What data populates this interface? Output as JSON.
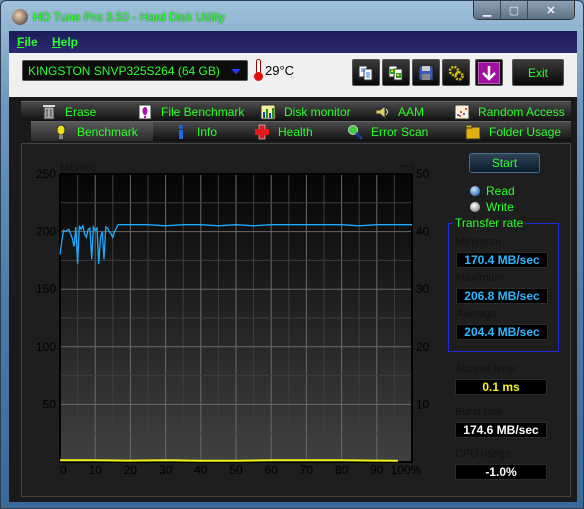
{
  "window": {
    "title": "HD Tune Pro 3.50 - Hard Disk Utility",
    "controls": [
      "minimize",
      "maximize",
      "close"
    ]
  },
  "menu": [
    {
      "label": "File",
      "accel": "F",
      "rest": "ile"
    },
    {
      "label": "Help",
      "accel": "H",
      "rest": "elp"
    }
  ],
  "toolbar": {
    "drive": "KINGSTON SNVP325S264 (64 GB)",
    "temperature": "29°C",
    "buttons": [
      {
        "name": "copy-text-button",
        "icon": "copy-text-icon"
      },
      {
        "name": "copy-screenshot-button",
        "icon": "copy-image-icon"
      },
      {
        "name": "save-button",
        "icon": "floppy-disk-icon"
      },
      {
        "name": "options-button",
        "icon": "gears-icon"
      },
      {
        "name": "download-button",
        "icon": "down-arrow-icon"
      }
    ],
    "exit_label": "Exit"
  },
  "tabs": {
    "row1": [
      {
        "label": "Erase",
        "icon": "trash-icon"
      },
      {
        "label": "File Benchmark",
        "icon": "file-benchmark-icon"
      },
      {
        "label": "Disk monitor",
        "icon": "bar-chart-icon"
      },
      {
        "label": "AAM",
        "icon": "speaker-icon"
      },
      {
        "label": "Random Access",
        "icon": "scatter-icon"
      }
    ],
    "row2": [
      {
        "label": "Benchmark",
        "icon": "lightbulb-icon",
        "active": true
      },
      {
        "label": "Info",
        "icon": "info-icon"
      },
      {
        "label": "Health",
        "icon": "health-cross-icon"
      },
      {
        "label": "Error Scan",
        "icon": "magnifier-icon"
      },
      {
        "label": "Folder Usage",
        "icon": "folder-icon"
      }
    ]
  },
  "benchmark": {
    "start_label": "Start",
    "modes": [
      {
        "label": "Read",
        "selected": true
      },
      {
        "label": "Write",
        "selected": false
      }
    ],
    "transfer_rate": {
      "title": "Transfer rate",
      "minimum_label": "Minimum",
      "minimum": "170.4 MB/sec",
      "maximum_label": "Maximum",
      "maximum": "206.8 MB/sec",
      "average_label": "Average:",
      "average": "204.4 MB/sec"
    },
    "access_time_label": "Access time:",
    "access_time": "0.1 ms",
    "burst_rate_label": "Burst rate",
    "burst_rate": "174.6 MB/sec",
    "cpu_usage_label": "CPU usage",
    "cpu_usage": "-1.0%"
  },
  "chart_data": {
    "type": "line",
    "title": "",
    "xlabel": "",
    "ylabel": "MB/sec",
    "y2label": "ms",
    "xlim": [
      0,
      100
    ],
    "ylim": [
      0,
      250
    ],
    "y2lim": [
      0,
      50
    ],
    "x_ticks": [
      "0",
      "10",
      "20",
      "30",
      "40",
      "50",
      "60",
      "70",
      "80",
      "90",
      "100%"
    ],
    "y_ticks": [
      "250",
      "200",
      "150",
      "100",
      "50"
    ],
    "y2_ticks": [
      "50",
      "40",
      "30",
      "20",
      "10"
    ],
    "grid": true,
    "series": [
      {
        "name": "Transfer rate",
        "axis": "left",
        "color": "#1eaaff",
        "x": [
          0,
          0.5,
          1,
          1.5,
          2,
          2.5,
          3,
          3.5,
          4,
          4.5,
          5,
          5.5,
          6,
          6.5,
          7,
          7.5,
          8,
          8.5,
          9,
          9.5,
          10,
          10.5,
          11,
          11.5,
          12,
          12.5,
          13,
          13.5,
          14,
          14.5,
          15,
          15.5,
          16,
          16.5,
          17,
          20,
          25,
          30,
          35,
          40,
          45,
          50,
          55,
          60,
          65,
          70,
          75,
          80,
          85,
          90,
          95,
          100
        ],
        "values": [
          180,
          192,
          201,
          200,
          201,
          202,
          198,
          194,
          187,
          204,
          172,
          205,
          202,
          205,
          198,
          195,
          202,
          203,
          176,
          204,
          201,
          203,
          172,
          195,
          200,
          176,
          204,
          203,
          200,
          198,
          195,
          200,
          203,
          206,
          206,
          206,
          206,
          205,
          206,
          206,
          205,
          206,
          205,
          206,
          206,
          206,
          206,
          206,
          205,
          206,
          206,
          206
        ]
      },
      {
        "name": "Access time",
        "axis": "right",
        "color": "#f4f41a",
        "x": [
          0,
          10,
          20,
          30,
          40,
          50,
          60,
          70,
          80,
          90,
          96
        ],
        "values": [
          0.3,
          0.3,
          0.25,
          0.3,
          0.2,
          0.2,
          0.3,
          0.3,
          0.3,
          0.25,
          0.2
        ]
      }
    ]
  }
}
